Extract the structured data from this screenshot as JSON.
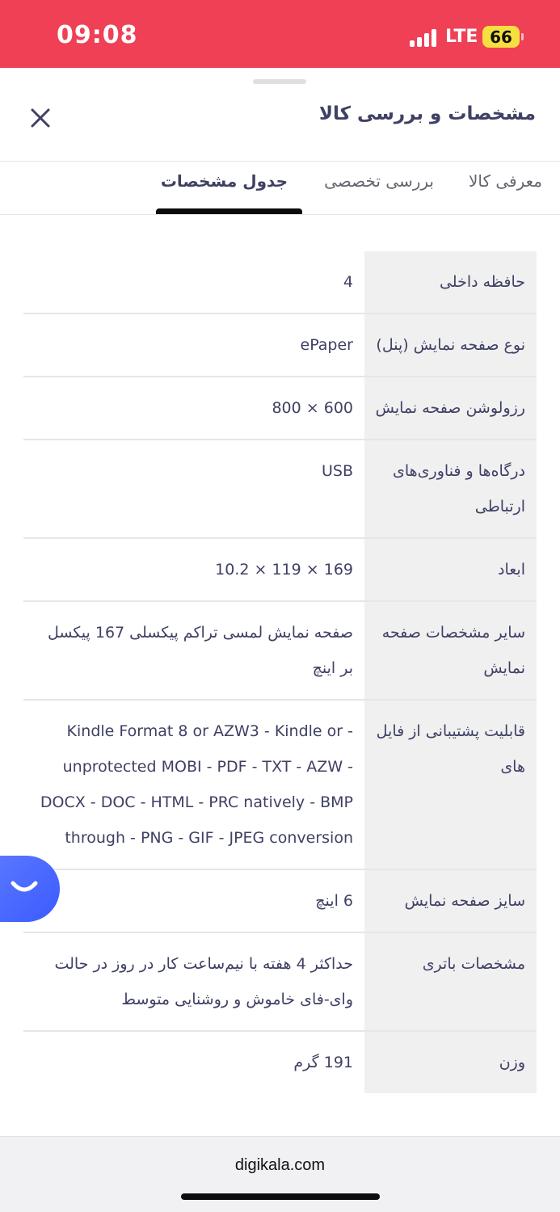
{
  "status_bar": {
    "time": "09:08",
    "network": "LTE",
    "battery": "66",
    "colors": {
      "background": "#ef4056",
      "battery": "#f6e03f"
    }
  },
  "sheet": {
    "title": "مشخصات و بررسی کالا",
    "close_icon": "close-icon"
  },
  "tabs": [
    {
      "label": "معرفی کالا",
      "active": false
    },
    {
      "label": "بررسی تخصصی",
      "active": false
    },
    {
      "label": "جدول مشخصات",
      "active": true
    }
  ],
  "specs": [
    {
      "label": "حافظه داخلی",
      "value": "4"
    },
    {
      "label": "نوع صفحه نمایش (پنل)",
      "value": "ePaper"
    },
    {
      "label": "رزولوشن صفحه نمایش",
      "value": "600 × 800"
    },
    {
      "label": "درگاه‌ها و فناوری‌های ارتباطی",
      "value": "USB"
    },
    {
      "label": "ابعاد",
      "value": "169 × 119 × 10.2"
    },
    {
      "label": "سایر مشخصات صفحه نمایش",
      "value": "صفحه نمایش لمسی تراکم پیکسلی 167 پیکسل بر اینچ"
    },
    {
      "label": "قابلیت پشتیبانی از فایل های",
      "value": "Kindle Format 8 or AZW3 - Kindle or - unprotected MOBI - PDF - TXT - AZW - DOCX - DOC - HTML - PRC natively - BMP through - PNG - GIF - JPEG conversion"
    },
    {
      "label": "سایز صفحه نمایش",
      "value": "6 اینچ"
    },
    {
      "label": "مشخصات باتری",
      "value": "حداکثر 4 هفته با نیم‌ساعت کار در روز در حالت وای-فای خاموش و روشنایی متوسط"
    },
    {
      "label": "وزن",
      "value": "191 گرم"
    }
  ],
  "chat_button": {
    "icon": "chat-smile-icon",
    "color": "#4a6bff"
  },
  "browser": {
    "url": "digikala.com"
  }
}
